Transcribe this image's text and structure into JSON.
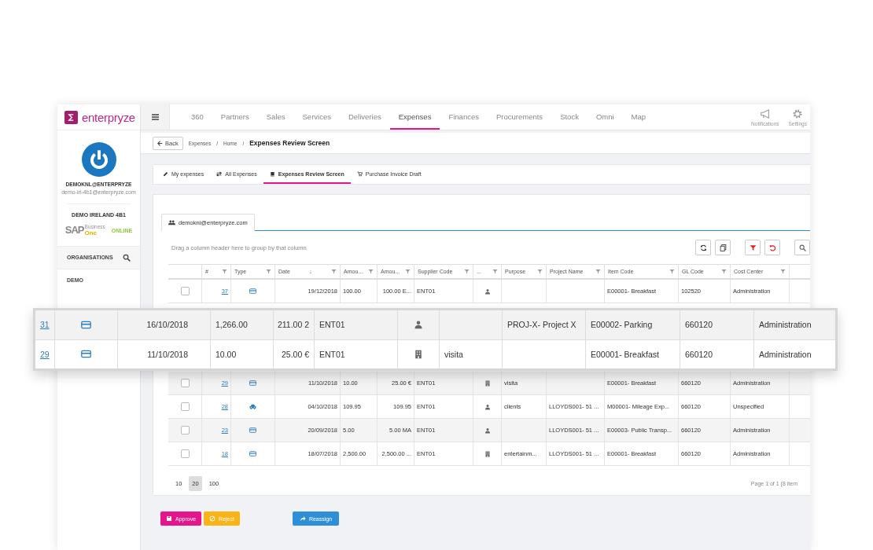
{
  "brand": {
    "name": "enterpryze"
  },
  "nav": {
    "items": [
      {
        "label": "360",
        "selected": false
      },
      {
        "label": "Partners",
        "selected": false
      },
      {
        "label": "Sales",
        "selected": false
      },
      {
        "label": "Services",
        "selected": false
      },
      {
        "label": "Deliveries",
        "selected": false
      },
      {
        "label": "Expenses",
        "selected": true
      },
      {
        "label": "Finances",
        "selected": false
      },
      {
        "label": "Procurements",
        "selected": false
      },
      {
        "label": "Stock",
        "selected": false
      },
      {
        "label": "Omni",
        "selected": false
      },
      {
        "label": "Map",
        "selected": false
      }
    ],
    "actions": [
      {
        "label": "Notifications"
      },
      {
        "label": "Settings"
      }
    ]
  },
  "sidebar": {
    "user": "DEMOKNL@ENTERPRYZE",
    "email": "demo-irl-4b1@enterpryze.com",
    "company": "DEMO IRELAND 4B1",
    "product": {
      "sap": "SAP",
      "business": "Business",
      "one": "One",
      "online": "ONLINE"
    },
    "sections": [
      {
        "label": "ORGANISATIONS",
        "kind": "search"
      },
      {
        "label": "DEMO",
        "kind": "plain"
      }
    ]
  },
  "breadcrumb": {
    "back": "Back",
    "items": [
      {
        "label": "Expenses",
        "separator": "/"
      },
      {
        "label": "Home",
        "separator": "/"
      }
    ],
    "current": "Expenses Review Screen"
  },
  "tabs": [
    {
      "label": "My expenses",
      "selected": false
    },
    {
      "label": "All Expenses",
      "selected": false
    },
    {
      "label": "Expenses Review Screen",
      "selected": true
    },
    {
      "label": "Purchase Invoice Draft",
      "selected": false
    }
  ],
  "user_tab": "demokni@enterpryze.com",
  "grid": {
    "group_hint": "Drag a column header here to group by that column",
    "columns": [
      {
        "label": "#"
      },
      {
        "label": "Type"
      },
      {
        "label": "Date",
        "sort": "↓"
      },
      {
        "label": "Amou..."
      },
      {
        "label": "Amou..."
      },
      {
        "label": "Supplier Code"
      },
      {
        "label": "..."
      },
      {
        "label": "Purpose"
      },
      {
        "label": "Project Name"
      },
      {
        "label": "Item Code"
      },
      {
        "label": "GL Code"
      },
      {
        "label": "Cost Center"
      }
    ],
    "rows": [
      {
        "checked": false,
        "id": "37",
        "type": {
          "kind": "card"
        },
        "date": "19/12/2018",
        "amount": "100.00",
        "amount_2": "100.00 E...",
        "supplier": "ENT01",
        "contact": {
          "kind": "person"
        },
        "item": "E00001- Breakfast",
        "gl": "102520",
        "cost_center": "Administration"
      },
      {
        "checked": false,
        "id": "29",
        "type": {
          "kind": "card"
        },
        "date": "11/10/2018",
        "amount": "10.00",
        "amount_2": "25.00 €",
        "supplier": "ENT01",
        "contact": {
          "kind": "building"
        },
        "purpose": "visita",
        "item": "E00001- Breakfast",
        "gl": "660120",
        "cost_center": "Administration"
      },
      {
        "checked": false,
        "id": "28",
        "type": {
          "kind": "car"
        },
        "date": "04/10/2018",
        "amount": "109.95",
        "amount_2": "109.95",
        "supplier": "ENT01",
        "contact": {
          "kind": "person"
        },
        "purpose": "clients",
        "project": "LLOYDS001- 51 ...",
        "item": "M00001- Mileage Exp...",
        "gl": "660120",
        "cost_center": "Unspecified"
      },
      {
        "checked": false,
        "id": "23",
        "type": {
          "kind": "card"
        },
        "date": "20/09/2018",
        "amount": "5.00",
        "amount_2": "5.00 MA",
        "supplier": "ENT01",
        "contact": {
          "kind": "person"
        },
        "project": "LLOYDS001- 51 ...",
        "item": "E00003- Public Transp...",
        "gl": "660120",
        "cost_center": "Administration"
      },
      {
        "checked": false,
        "id": "18",
        "type": {
          "kind": "card"
        },
        "date": "18/07/2018",
        "amount": "2,500.00",
        "amount_2": "2,500.00 ...",
        "supplier": "ENT01",
        "contact": {
          "kind": "building"
        },
        "purpose": "entertainm...",
        "project": "LLOYDS001- 51 ...",
        "item": "E00001- Breakfast",
        "gl": "660120",
        "cost_center": "Administration"
      }
    ],
    "page_sizes": [
      {
        "label": "10",
        "selected": false
      },
      {
        "label": "20",
        "selected": true
      },
      {
        "label": "100",
        "selected": false
      }
    ],
    "page_info": "Page 1 of 1 (8 item"
  },
  "buttons": [
    {
      "label": "Approve",
      "kind": "approve"
    },
    {
      "label": "Reject",
      "kind": "reject"
    },
    {
      "label": "Reassign",
      "kind": "reassign"
    }
  ],
  "magnifier": {
    "rows": [
      {
        "id": "31",
        "type": {
          "kind": "card"
        },
        "date": "16/10/2018",
        "amount": "1,266.00",
        "amount_2": "211.00 2",
        "supplier": "ENT01",
        "contact": {
          "kind": "person"
        },
        "project": "PROJ-X- Project X",
        "item": "E00002- Parking",
        "gl": "660120",
        "cost_center": "Administration"
      },
      {
        "id": "29",
        "type": {
          "kind": "card"
        },
        "date": "11/10/2018",
        "amount": "10.00",
        "amount_2": "25.00 €",
        "supplier": "ENT01",
        "contact": {
          "kind": "building"
        },
        "purpose": "visita",
        "item": "E00001- Breakfast",
        "gl": "660120",
        "cost_center": "Administration"
      }
    ]
  }
}
